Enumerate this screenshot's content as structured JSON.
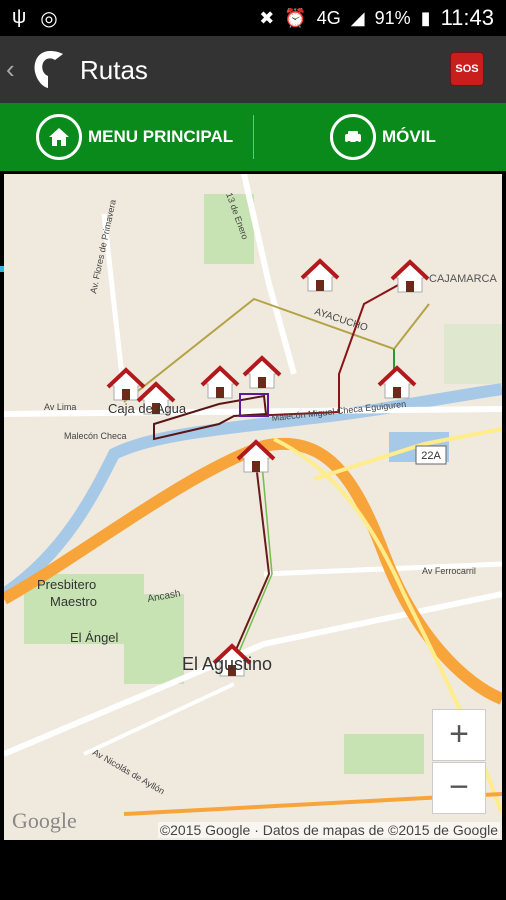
{
  "status": {
    "battery": "91%",
    "network": "4G",
    "time": "11:43"
  },
  "actionbar": {
    "title": "Rutas",
    "sos": "SOS"
  },
  "tabs": {
    "menu": "MENU PRINCIPAL",
    "movil": "MÓVIL"
  },
  "map": {
    "labels": {
      "ayacucho": "AYACUCHO",
      "cajamarca": "CAJAMARCA",
      "caja_agua": "Caja de Agua",
      "presbitero": "Presbitero",
      "maestro": "Maestro",
      "el_angel": "El Ángel",
      "el_agustino": "El Agustino",
      "av_lima": "Av Lima",
      "ancash": "Ancash",
      "av_ferrocarril": "Av Ferrocarril",
      "malecon_checa": "Malecón Checa",
      "malecon_miguel": "Malecón Miguel Checa Eguiguren",
      "av_flores": "Av. Flores de Primavera",
      "av_nicolas": "Av Nicolás de Ayllón",
      "tres_de_enero": "13 de Enero",
      "route_22a": "22A"
    },
    "zoom_in": "+",
    "zoom_out": "−",
    "copyright": "©2015 Google · Datos de mapas de ©2015 de Google",
    "google": "Google"
  }
}
